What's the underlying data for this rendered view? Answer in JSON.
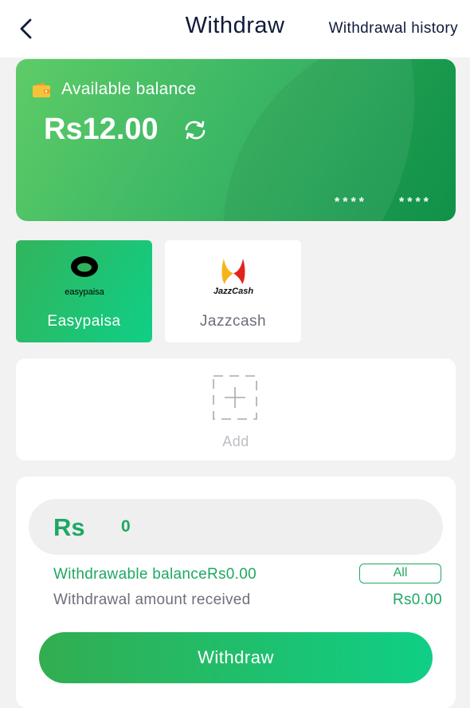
{
  "header": {
    "title": "Withdraw",
    "history_link": "Withdrawal history"
  },
  "balance_card": {
    "label": "Available balance",
    "amount": "Rs12.00",
    "card_mask_1": "****",
    "card_mask_2": "****",
    "wallet_icon": "wallet-icon",
    "refresh_icon": "refresh-icon"
  },
  "methods": [
    {
      "label": "Easypaisa",
      "logo_text": "easypaisa",
      "selected": true
    },
    {
      "label": "Jazzcash",
      "logo_text": "JazzCash",
      "selected": false
    }
  ],
  "add_method": {
    "label": "Add"
  },
  "form": {
    "currency": "Rs",
    "amount_value": "0",
    "withdrawable": "Withdrawable balanceRs0.00",
    "all_label": "All",
    "received_label": "Withdrawal amount received",
    "received_value": "Rs0.00",
    "submit_label": "Withdraw"
  },
  "colors": {
    "accent": "#1ea863",
    "title": "#101a3a",
    "background": "#f2f2f2"
  }
}
